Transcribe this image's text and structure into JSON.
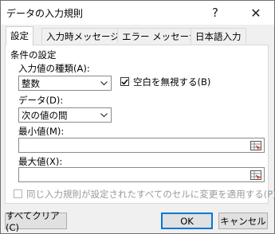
{
  "window": {
    "title": "データの入力規則",
    "help_glyph": "?",
    "close_glyph": "✕"
  },
  "tabs": [
    {
      "label": "設定"
    },
    {
      "label": "入力時メッセージ"
    },
    {
      "label": "エラー メッセージ"
    },
    {
      "label": "日本語入力"
    }
  ],
  "settings": {
    "group_label": "条件の設定",
    "allow_label": "入力値の種類(A):",
    "allow_value": "整数",
    "ignore_blank_label": "空白を無視する(B)",
    "ignore_blank_checked": true,
    "data_label": "データ(D):",
    "data_value": "次の値の間",
    "min_label": "最小値(M):",
    "min_value": "",
    "max_label": "最大値(X):",
    "max_value": "",
    "apply_all_label": "同じ入力規則が設定されたすべてのセルに変更を適用する(P)",
    "apply_all_checked": false
  },
  "buttons": {
    "clear_all": "すべてクリア(C)",
    "ok": "OK",
    "cancel": "キャンセル"
  }
}
